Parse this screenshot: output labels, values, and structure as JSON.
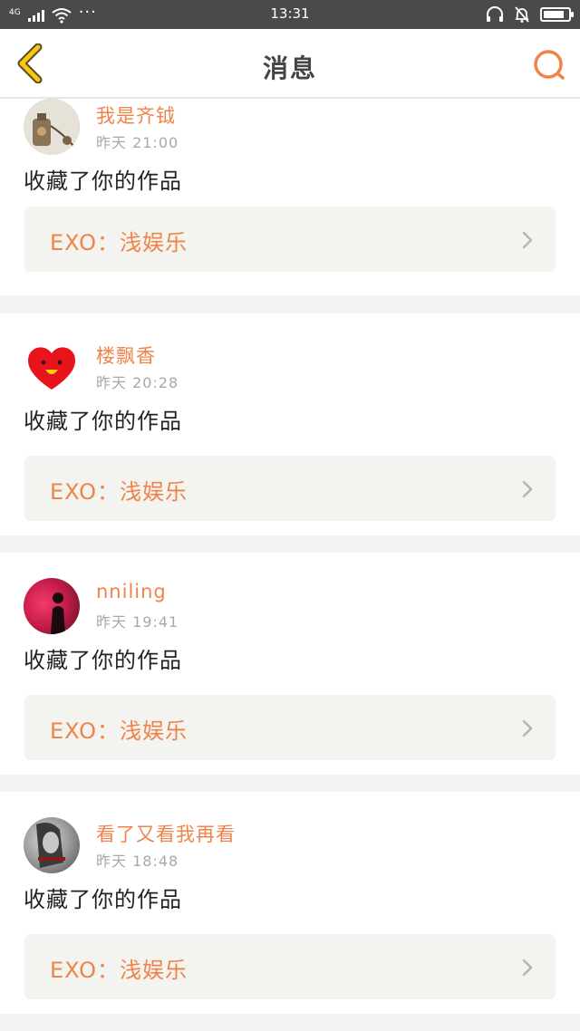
{
  "status_bar": {
    "network": "4G",
    "more": "···",
    "time": "13:31",
    "battery_level": 0.85
  },
  "nav": {
    "title": "消息",
    "back_icon": "chevron-left-icon",
    "search_icon": "search-icon",
    "accent": "#f0834a",
    "back_color": "#f5c518"
  },
  "feed": {
    "items": [
      {
        "username": "我是齐钺",
        "time": "昨天 21:00",
        "action": "收藏了你的作品",
        "work_title": "EXO：浅娱乐",
        "avatar": "bottle-photo"
      },
      {
        "username": "楼飘香",
        "time": "昨天 20:28",
        "action": "收藏了你的作品",
        "work_title": "EXO：浅娱乐",
        "avatar": "red-heart-face"
      },
      {
        "username": "nniling",
        "time": "昨天 19:41",
        "action": "收藏了你的作品",
        "work_title": "EXO：浅娱乐",
        "avatar": "pink-smoke-silhouette"
      },
      {
        "username": "看了又看我再看",
        "time": "昨天 18:48",
        "action": "收藏了你的作品",
        "work_title": "EXO：浅娱乐",
        "avatar": "grey-portrait"
      }
    ]
  }
}
